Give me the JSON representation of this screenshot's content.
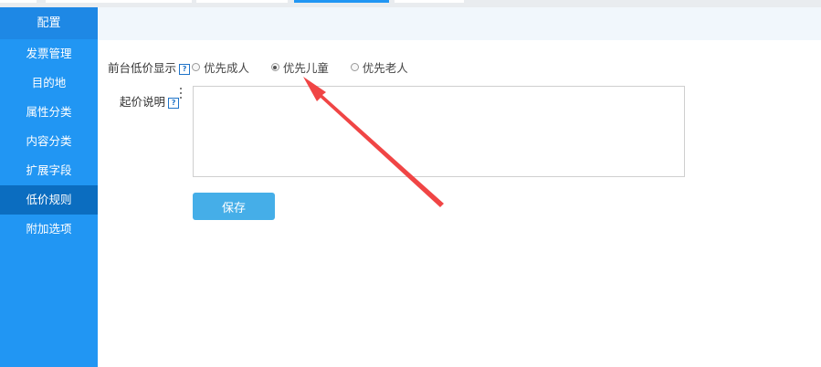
{
  "sidebar": {
    "header": "配置",
    "items": [
      {
        "label": "发票管理",
        "active": false
      },
      {
        "label": "目的地",
        "active": false
      },
      {
        "label": "属性分类",
        "active": false
      },
      {
        "label": "内容分类",
        "active": false
      },
      {
        "label": "扩展字段",
        "active": false
      },
      {
        "label": "低价规则",
        "active": true
      },
      {
        "label": "附加选项",
        "active": false
      }
    ]
  },
  "form": {
    "lowprice_label": "前台低价显示",
    "options": [
      {
        "label": "优先成人",
        "checked": false
      },
      {
        "label": "优先儿童",
        "checked": true
      },
      {
        "label": "优先老人",
        "checked": false
      }
    ],
    "desc_label": "起价说明",
    "desc_value": "",
    "save_label": "保存"
  },
  "icons": {
    "help": "?"
  },
  "colors": {
    "sidebar": "#2196f3",
    "active_item": "#0b6dc0",
    "button": "#45aee8",
    "arrow": "#f04545"
  }
}
